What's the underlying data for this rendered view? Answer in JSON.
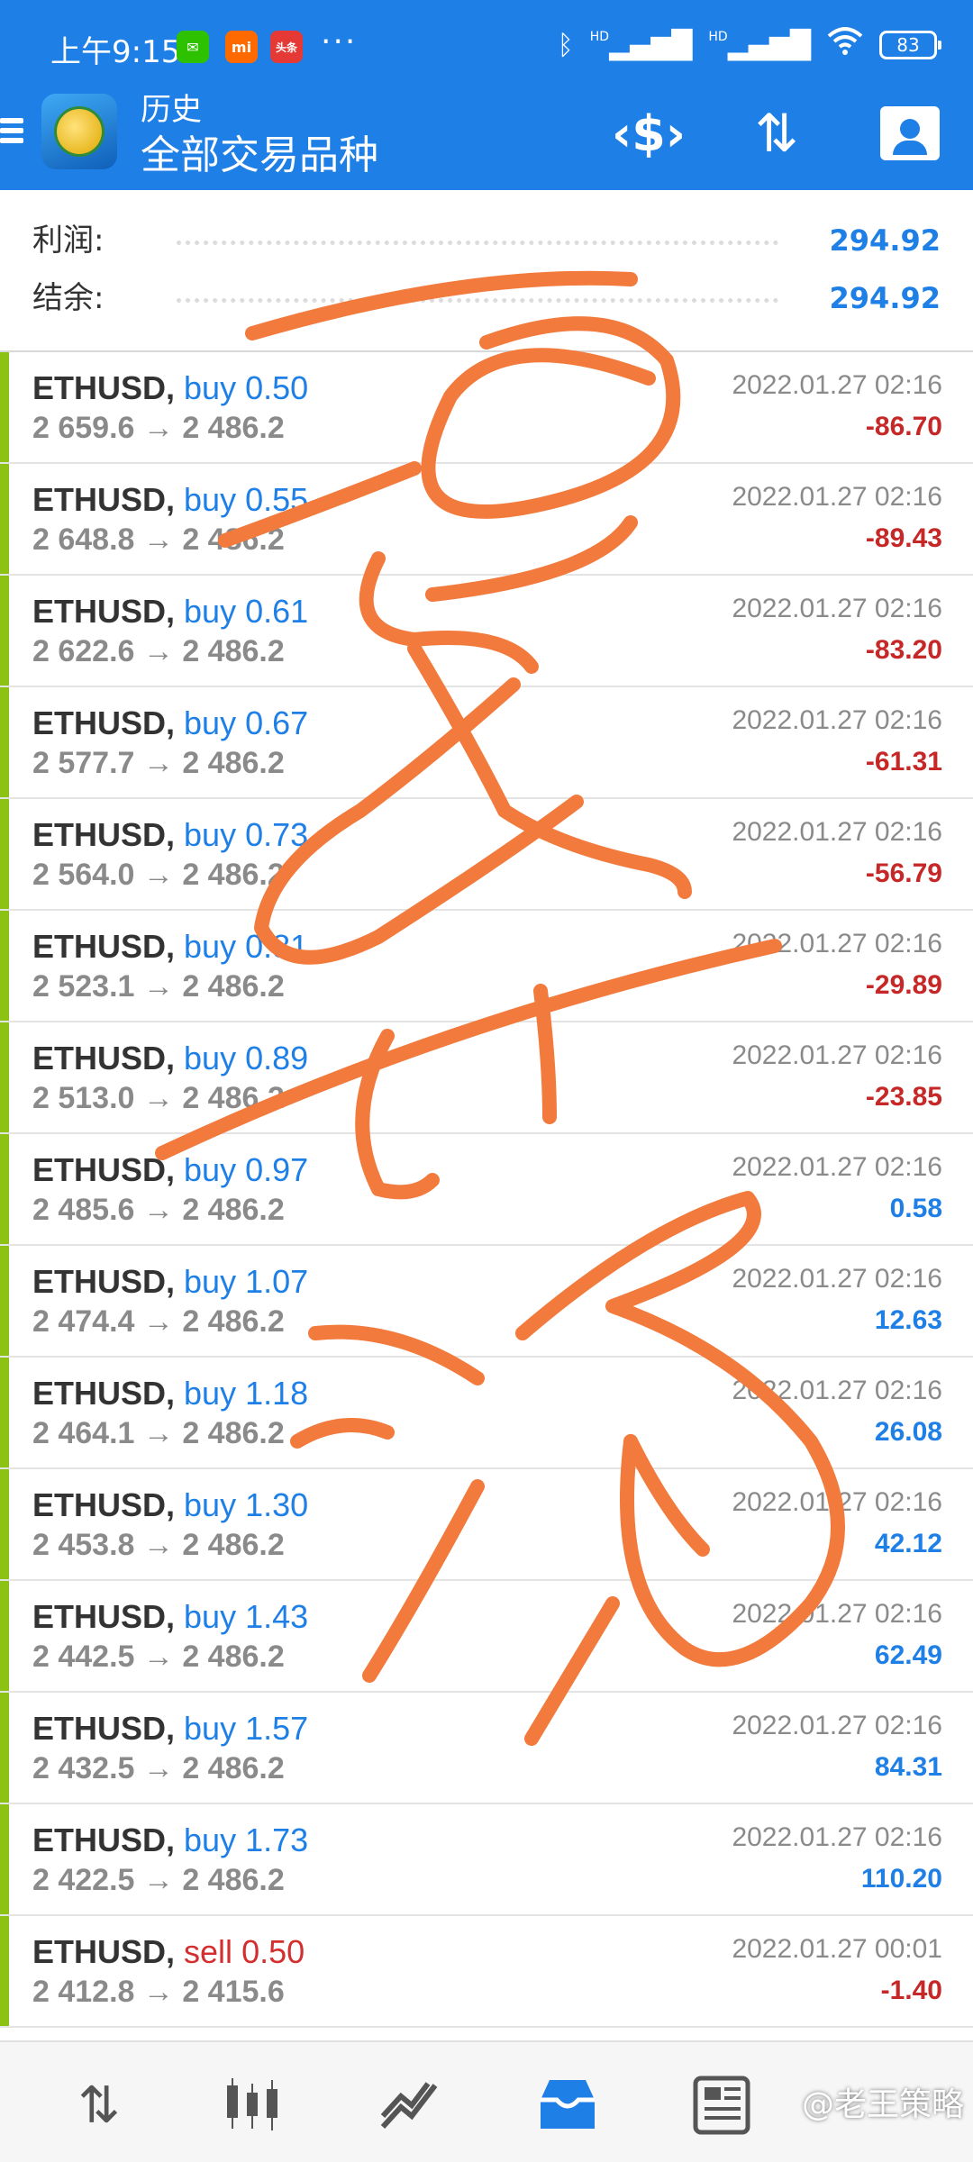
{
  "status_bar": {
    "time": "上午9:15",
    "more": "···",
    "hd1": "HD",
    "hd2": "HD",
    "battery": "83"
  },
  "toolbar": {
    "subtitle": "历史",
    "title": "全部交易品种",
    "icons": [
      "menu-icon",
      "app-logo",
      "dollar-swap-icon",
      "sort-icon",
      "calendar-person-icon"
    ]
  },
  "summary": {
    "profit_label": "利润:",
    "profit_value": "294.92",
    "balance_label": "结余:",
    "balance_value": "294.92"
  },
  "trades": [
    {
      "symbol": "ETHUSD,",
      "side": "buy",
      "volume": "0.50",
      "prices": "2 659.6 → 2 486.2",
      "date": "2022.01.27 02:16",
      "profit": "-86.70"
    },
    {
      "symbol": "ETHUSD,",
      "side": "buy",
      "volume": "0.55",
      "prices": "2 648.8 → 2 486.2",
      "date": "2022.01.27 02:16",
      "profit": "-89.43"
    },
    {
      "symbol": "ETHUSD,",
      "side": "buy",
      "volume": "0.61",
      "prices": "2 622.6 → 2 486.2",
      "date": "2022.01.27 02:16",
      "profit": "-83.20"
    },
    {
      "symbol": "ETHUSD,",
      "side": "buy",
      "volume": "0.67",
      "prices": "2 577.7 → 2 486.2",
      "date": "2022.01.27 02:16",
      "profit": "-61.31"
    },
    {
      "symbol": "ETHUSD,",
      "side": "buy",
      "volume": "0.73",
      "prices": "2 564.0 → 2 486.2",
      "date": "2022.01.27 02:16",
      "profit": "-56.79"
    },
    {
      "symbol": "ETHUSD,",
      "side": "buy",
      "volume": "0.81",
      "prices": "2 523.1 → 2 486.2",
      "date": "2022.01.27 02:16",
      "profit": "-29.89"
    },
    {
      "symbol": "ETHUSD,",
      "side": "buy",
      "volume": "0.89",
      "prices": "2 513.0 → 2 486.2",
      "date": "2022.01.27 02:16",
      "profit": "-23.85"
    },
    {
      "symbol": "ETHUSD,",
      "side": "buy",
      "volume": "0.97",
      "prices": "2 485.6 → 2 486.2",
      "date": "2022.01.27 02:16",
      "profit": "0.58"
    },
    {
      "symbol": "ETHUSD,",
      "side": "buy",
      "volume": "1.07",
      "prices": "2 474.4 → 2 486.2",
      "date": "2022.01.27 02:16",
      "profit": "12.63"
    },
    {
      "symbol": "ETHUSD,",
      "side": "buy",
      "volume": "1.18",
      "prices": "2 464.1 → 2 486.2",
      "date": "2022.01.27 02:16",
      "profit": "26.08"
    },
    {
      "symbol": "ETHUSD,",
      "side": "buy",
      "volume": "1.30",
      "prices": "2 453.8 → 2 486.2",
      "date": "2022.01.27 02:16",
      "profit": "42.12"
    },
    {
      "symbol": "ETHUSD,",
      "side": "buy",
      "volume": "1.43",
      "prices": "2 442.5 → 2 486.2",
      "date": "2022.01.27 02:16",
      "profit": "62.49"
    },
    {
      "symbol": "ETHUSD,",
      "side": "buy",
      "volume": "1.57",
      "prices": "2 432.5 → 2 486.2",
      "date": "2022.01.27 02:16",
      "profit": "84.31"
    },
    {
      "symbol": "ETHUSD,",
      "side": "buy",
      "volume": "1.73",
      "prices": "2 422.5 → 2 486.2",
      "date": "2022.01.27 02:16",
      "profit": "110.20"
    },
    {
      "symbol": "ETHUSD,",
      "side": "sell",
      "volume": "0.50",
      "prices": "2 412.8 → 2 415.6",
      "date": "2022.01.27 00:01",
      "profit": "-1.40"
    }
  ],
  "bottom_nav": {
    "items": [
      "quotes-icon",
      "chart-icon",
      "trade-icon",
      "history-icon",
      "news-icon"
    ],
    "active": "history-icon",
    "watermark": "@老王策略"
  },
  "colors": {
    "header": "#1e7fe6",
    "buy": "#1e7fe6",
    "sell": "#d32f2f",
    "loss": "#c62828",
    "gain": "#1e7fe6",
    "row_bar": "#8cc312",
    "scribble": "#f27a3c"
  }
}
